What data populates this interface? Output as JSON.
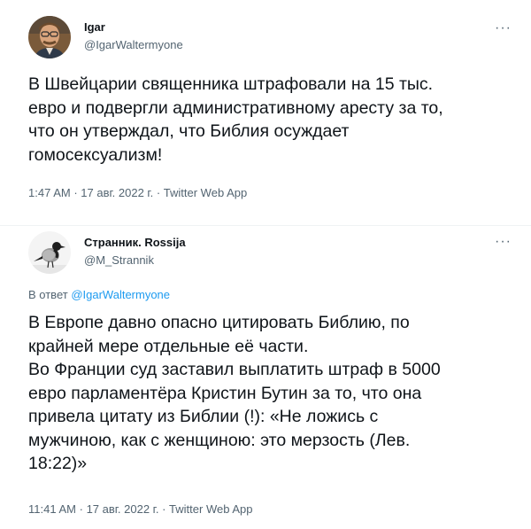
{
  "tweet1": {
    "display_name": "Igar",
    "handle": "@IgarWaltermyone",
    "more_label": "···",
    "text_lines": [
      "В Швейцарии священника штрафовали на 15 тыс.",
      "евро и подвергли административному аресту за то,",
      "что он утверждал, что Библия осуждает",
      "гомосексуализм!"
    ],
    "time": "1:47 AM",
    "date": "17 авг. 2022 г.",
    "source": "Twitter Web App",
    "separator": "·"
  },
  "tweet2": {
    "display_name": "Странник. Rossija",
    "handle": "@M_Strannik",
    "more_label": "···",
    "reply_prefix": "В ответ",
    "reply_mention": "@IgarWaltermyone",
    "text_lines": [
      "В Европе давно опасно цитировать Библию, по",
      "крайней мере отдельные её части.",
      "Во Франции суд заставил выплатить штраф в 5000",
      "евро парламентёра Кристин Бутин за то, что она",
      "привела цитату из Библии (!): «Не ложись с",
      "мужчиною, как с женщиною: это мерзость (Лев.",
      "18:22)»"
    ],
    "time": "11:41 AM",
    "date": "17 авг. 2022 г.",
    "source": "Twitter Web App",
    "separator": "·"
  },
  "colors": {
    "text": "#0f1419",
    "secondary": "#536471",
    "link": "#1d9bf0",
    "divider": "#eff3f4"
  }
}
